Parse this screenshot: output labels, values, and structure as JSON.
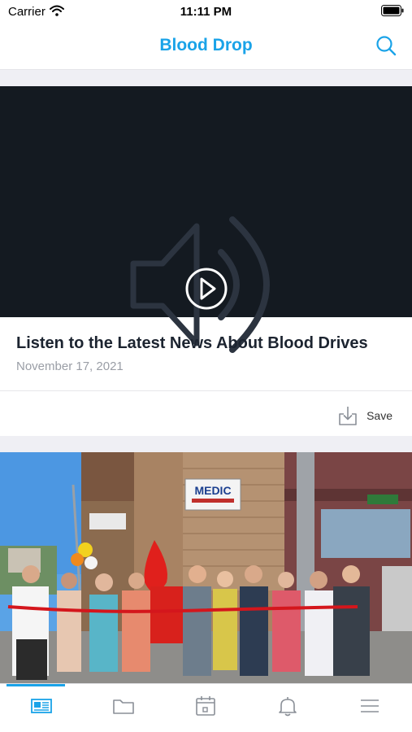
{
  "status_bar": {
    "carrier": "Carrier",
    "time": "11:11 PM"
  },
  "nav": {
    "title": "Blood Drop",
    "icon": "search-icon"
  },
  "feed": {
    "items": [
      {
        "type": "audio",
        "title": "Listen to the Latest News About Blood Drives",
        "date": "November 17, 2021",
        "save_label": "Save"
      },
      {
        "type": "photo",
        "photo_sign": "MEDIC"
      }
    ]
  },
  "tab_bar": {
    "tabs": [
      {
        "icon": "newspaper-icon",
        "active": true
      },
      {
        "icon": "folder-icon",
        "active": false
      },
      {
        "icon": "calendar-icon",
        "active": false
      },
      {
        "icon": "bell-icon",
        "active": false
      },
      {
        "icon": "menu-icon",
        "active": false
      }
    ]
  },
  "colors": {
    "accent": "#1aa3e8",
    "media_bg": "#141a21"
  }
}
